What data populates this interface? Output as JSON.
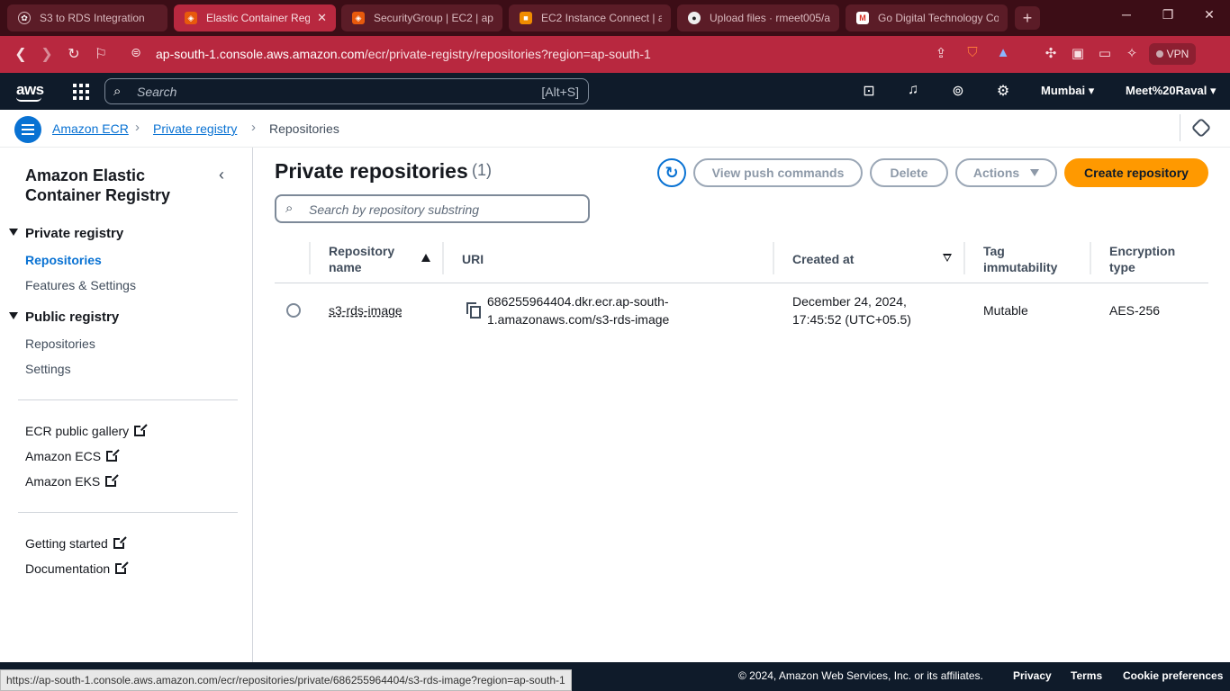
{
  "browser": {
    "tabs": [
      {
        "title": "S3 to RDS Integration",
        "active": false,
        "favicon": "chatgpt-icon"
      },
      {
        "title": "Elastic Container Reg",
        "active": true,
        "favicon": "aws-ecr-icon"
      },
      {
        "title": "SecurityGroup | EC2 | ap-",
        "active": false,
        "favicon": "aws-ec2-icon"
      },
      {
        "title": "EC2 Instance Connect | ap",
        "active": false,
        "favicon": "aws-cube-icon"
      },
      {
        "title": "Upload files · rmeet005/a",
        "active": false,
        "favicon": "github-icon"
      },
      {
        "title": "Go Digital Technology Co",
        "active": false,
        "favicon": "gmail-icon"
      }
    ],
    "url_host": "ap-south-1.console.aws.amazon.com",
    "url_path": "/ecr/private-registry/repositories?region=ap-south-1",
    "vpn_label": "VPN",
    "brave_badge": "1",
    "status_url": "https://ap-south-1.console.aws.amazon.com/ecr/repositories/private/686255964404/s3-rds-image?region=ap-south-1"
  },
  "aws_header": {
    "logo": "aws",
    "search_placeholder": "Search",
    "search_shortcut": "[Alt+S]",
    "region": "Mumbai",
    "account": "Meet%20Raval"
  },
  "breadcrumb": {
    "items": [
      "Amazon ECR",
      "Private registry",
      "Repositories"
    ]
  },
  "sidenav": {
    "title": "Amazon Elastic Container Registry",
    "private_registry": "Private registry",
    "private_items": [
      "Repositories",
      "Features & Settings"
    ],
    "public_registry": "Public registry",
    "public_items": [
      "Repositories",
      "Settings"
    ],
    "external_links": [
      "ECR public gallery",
      "Amazon ECS",
      "Amazon EKS"
    ],
    "help_links": [
      "Getting started",
      "Documentation"
    ]
  },
  "main": {
    "title": "Private repositories",
    "count": "(1)",
    "buttons": {
      "view_push": "View push commands",
      "delete": "Delete",
      "actions": "Actions",
      "create": "Create repository"
    },
    "search_placeholder": "Search by repository substring",
    "table": {
      "headers": {
        "name": "Repository name",
        "uri": "URI",
        "created": "Created at",
        "tag": "Tag immutability",
        "encryption": "Encryption type"
      },
      "rows": [
        {
          "name": "s3-rds-image",
          "uri_line1": "686255964404.dkr.ecr.ap-south-",
          "uri_line2": "1.amazonaws.com/s3-rds-image",
          "created_line1": "December 24, 2024,",
          "created_line2": "17:45:52 (UTC+05.5)",
          "tag": "Mutable",
          "encryption": "AES-256"
        }
      ]
    }
  },
  "footer": {
    "copyright": "© 2024, Amazon Web Services, Inc. or its affiliates.",
    "links": [
      "Privacy",
      "Terms",
      "Cookie preferences"
    ]
  }
}
